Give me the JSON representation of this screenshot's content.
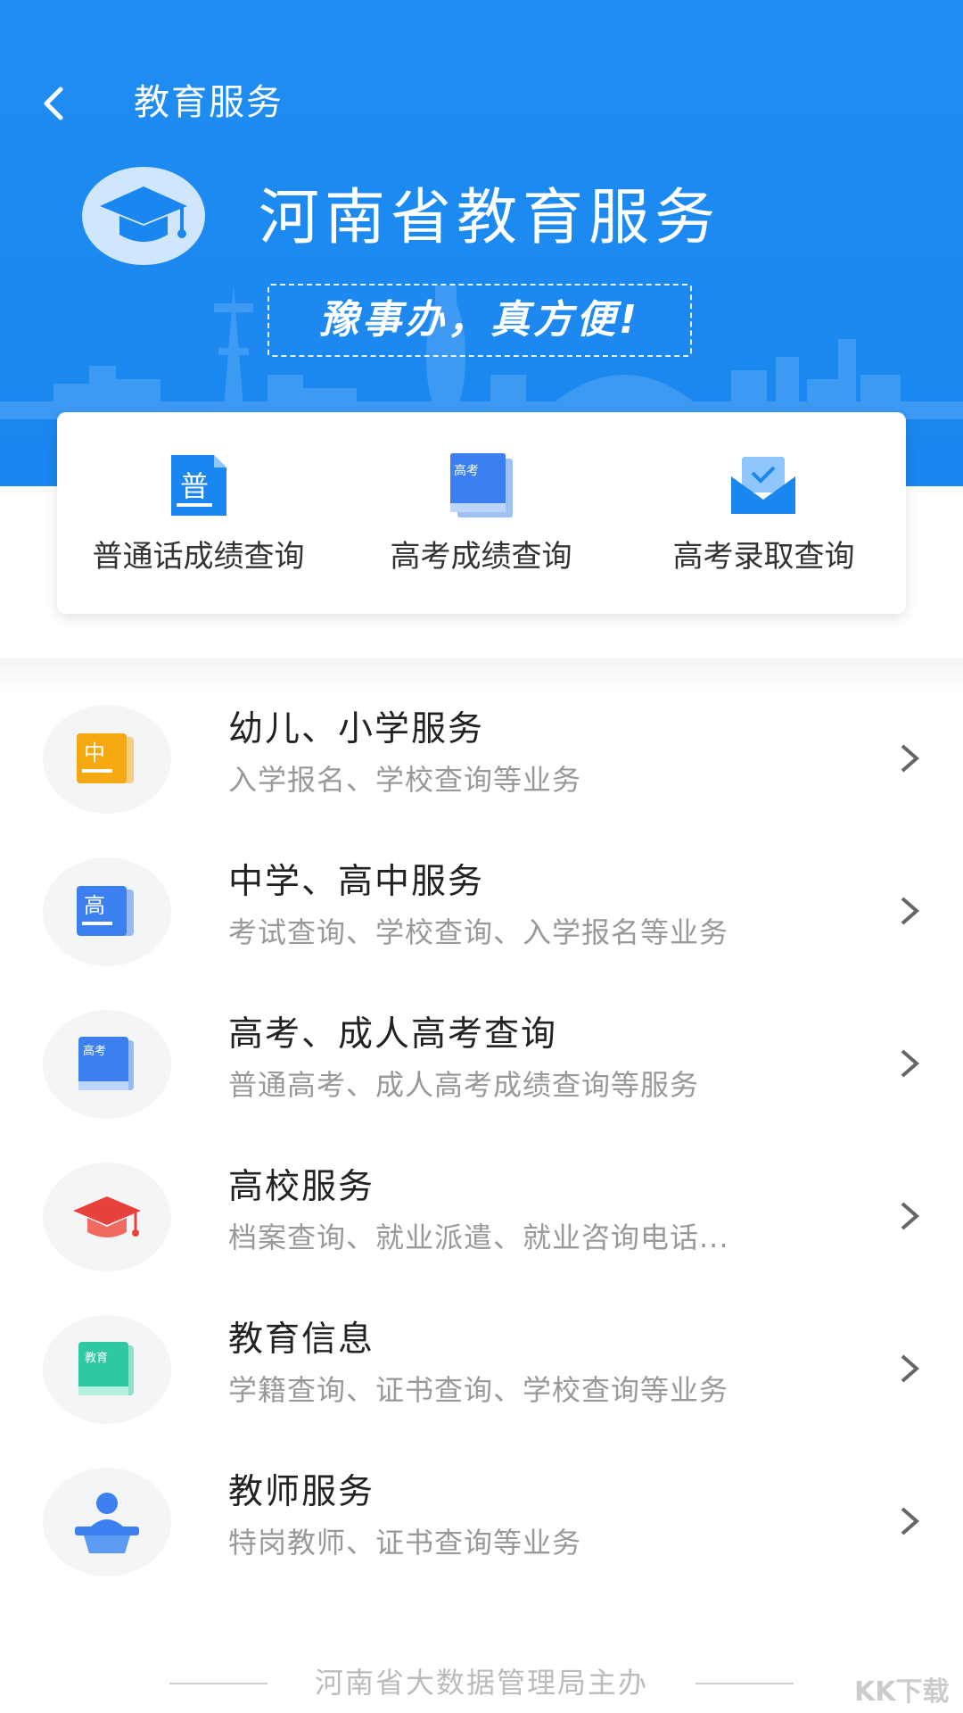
{
  "colors": {
    "hero_blue": "#1a86ef",
    "card_bg": "#ffffff",
    "subtitle_gray": "#999999"
  },
  "topbar": {
    "title": "教育服务"
  },
  "hero": {
    "title": "河南省教育服务",
    "slogan": "豫事办，真方便!"
  },
  "quick_links": [
    {
      "label": "普通话成绩查询",
      "icon": "putonghua-doc-icon",
      "icon_text": "普"
    },
    {
      "label": "高考成绩查询",
      "icon": "gaokao-book-icon",
      "icon_text": "高考"
    },
    {
      "label": "高考录取查询",
      "icon": "admission-envelope-icon"
    }
  ],
  "services": [
    {
      "title": "幼儿、小学服务",
      "subtitle": "入学报名、学校查询等业务",
      "icon": "primary-school-book-icon",
      "icon_text": "中"
    },
    {
      "title": "中学、高中服务",
      "subtitle": "考试查询、学校查询、入学报名等业务",
      "icon": "high-school-book-icon",
      "icon_text": "高"
    },
    {
      "title": "高考、成人高考查询",
      "subtitle": "普通高考、成人高考成绩查询等服务",
      "icon": "gaokao-book-icon",
      "icon_text": "高考"
    },
    {
      "title": "高校服务",
      "subtitle": "档案查询、就业派遣、就业咨询电话...",
      "icon": "graduation-cap-icon"
    },
    {
      "title": "教育信息",
      "subtitle": "学籍查询、证书查询、学校查询等业务",
      "icon": "education-book-icon",
      "icon_text": "教育"
    },
    {
      "title": "教师服务",
      "subtitle": "特岗教师、证书查询等业务",
      "icon": "teacher-podium-icon"
    }
  ],
  "footer": {
    "text": "河南省大数据管理局主办"
  },
  "watermark": {
    "text": "KK下载"
  }
}
